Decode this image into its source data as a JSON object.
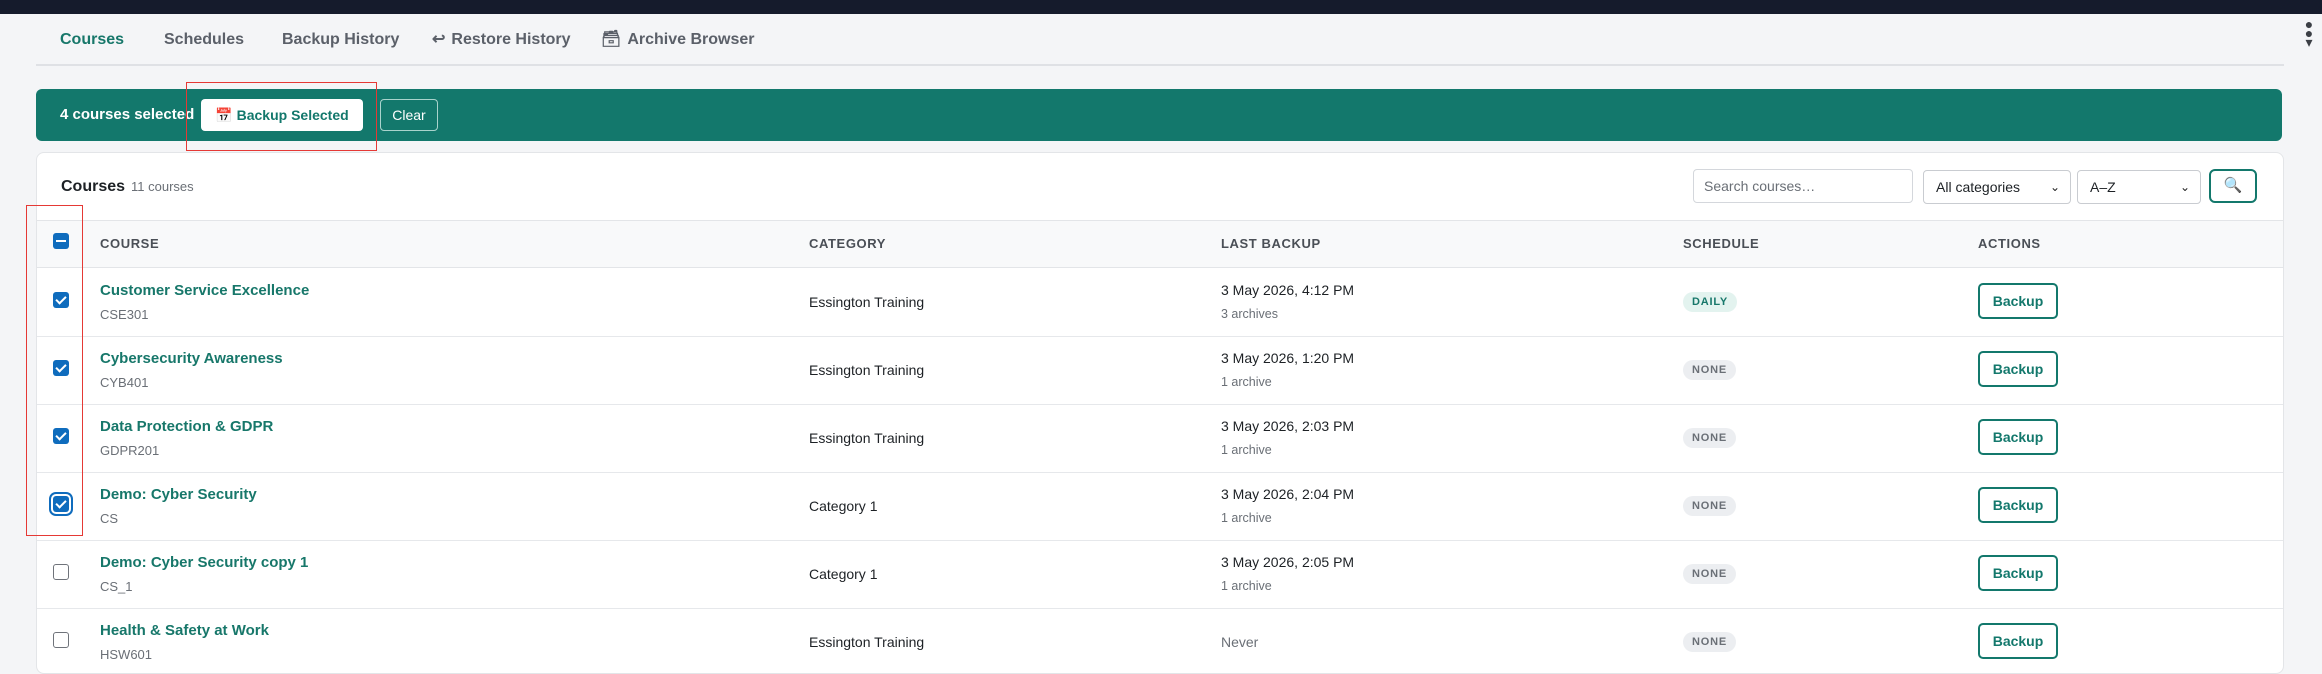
{
  "tabs": [
    {
      "label": "Courses",
      "icon": "",
      "active": true
    },
    {
      "label": "Schedules",
      "icon": ""
    },
    {
      "label": "Backup History",
      "icon": ""
    },
    {
      "label": "Restore History",
      "icon": "↩"
    },
    {
      "label": "Archive Browser",
      "icon": "🗃"
    }
  ],
  "selection_banner": {
    "count_text": "4 courses selected",
    "backup_button": {
      "icon": "📅",
      "label": "Backup Selected"
    },
    "clear_button": "Clear",
    "background_color": "#13786c"
  },
  "courses_panel": {
    "title": "Courses",
    "count": "11 courses",
    "search_placeholder": "Search courses…",
    "category_filter": "All categories",
    "sort": "A–Z",
    "search_button_icon": "🔍"
  },
  "table": {
    "headers": {
      "course": "COURSE",
      "category": "CATEGORY",
      "last_backup": "LAST BACKUP",
      "schedule": "SCHEDULE",
      "actions": "ACTIONS"
    },
    "select_all_state": "indeterminate",
    "rows": [
      {
        "selected": true,
        "name": "Customer Service Excellence",
        "code": "CSE301",
        "category": "Essington Training",
        "last_backup": "3 May 2026, 4:12 PM",
        "archives": "3 archives",
        "schedule": "DAILY",
        "action": "Backup"
      },
      {
        "selected": true,
        "name": "Cybersecurity Awareness",
        "code": "CYB401",
        "category": "Essington Training",
        "last_backup": "3 May 2026, 1:20 PM",
        "archives": "1 archive",
        "schedule": "NONE",
        "action": "Backup"
      },
      {
        "selected": true,
        "name": "Data Protection & GDPR",
        "code": "GDPR201",
        "category": "Essington Training",
        "last_backup": "3 May 2026, 2:03 PM",
        "archives": "1 archive",
        "schedule": "NONE",
        "action": "Backup"
      },
      {
        "selected": true,
        "name": "Demo: Cyber Security",
        "code": "CS",
        "category": "Category 1",
        "last_backup": "3 May 2026, 2:04 PM",
        "archives": "1 archive",
        "schedule": "NONE",
        "action": "Backup"
      },
      {
        "selected": false,
        "name": "Demo: Cyber Security copy 1",
        "code": "CS_1",
        "category": "Category 1",
        "last_backup": "3 May 2026, 2:05 PM",
        "archives": "1 archive",
        "schedule": "NONE",
        "action": "Backup"
      },
      {
        "selected": false,
        "name": "Health & Safety at Work",
        "code": "HSW601",
        "category": "Essington Training",
        "last_backup": "Never",
        "archives": "",
        "schedule": "NONE",
        "action": "Backup"
      }
    ]
  },
  "colors": {
    "accent": "#13786c",
    "checkbox": "#0f6cbd",
    "highlight": "#e53935"
  }
}
